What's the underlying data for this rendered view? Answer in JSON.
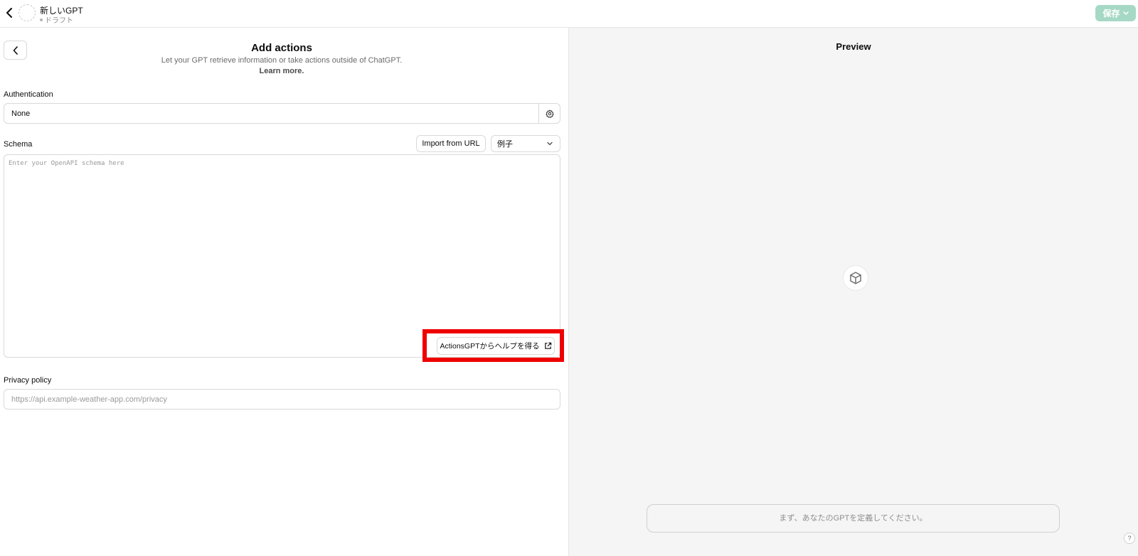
{
  "header": {
    "gpt_name": "新しいGPT",
    "gpt_status": "ドラフト",
    "save_label": "保存"
  },
  "actions": {
    "title": "Add actions",
    "subtitle": "Let your GPT retrieve information or take actions outside of ChatGPT.",
    "learn_more": "Learn more."
  },
  "authentication": {
    "label": "Authentication",
    "value": "None"
  },
  "schema": {
    "label": "Schema",
    "import_label": "Import from URL",
    "example_label": "例子",
    "placeholder": "Enter your OpenAPI schema here",
    "help_label": "ActionsGPTからヘルプを得る"
  },
  "privacy": {
    "label": "Privacy policy",
    "placeholder": "https://api.example-weather-app.com/privacy"
  },
  "preview": {
    "title": "Preview",
    "input_placeholder": "まず、あなたのGPTを定義してください。",
    "help_mark": "?"
  },
  "colors": {
    "save_button": "#a6d9c5",
    "highlight": "#ef0000",
    "preview_bg": "#f5f5f5"
  },
  "icons": {
    "back": "chevron-left-icon",
    "gear": "gear-icon",
    "chevron": "chevron-down-icon",
    "external": "external-link-icon",
    "cube": "cube-icon"
  }
}
